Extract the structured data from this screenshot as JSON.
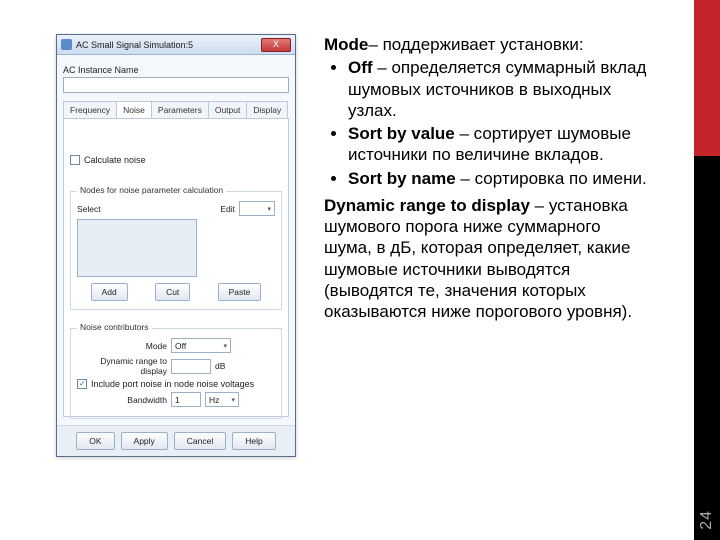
{
  "page_number": "24",
  "dialog": {
    "title": "AC Small Signal Simulation:5",
    "close": "X",
    "instance_label": "AC Instance Name",
    "tabs": [
      "Frequency",
      "Noise",
      "Parameters",
      "Output",
      "Display"
    ],
    "calc_noise": "Calculate noise",
    "nodes_group": {
      "legend": "Nodes for noise parameter calculation",
      "select_label": "Select",
      "edit_label": "Edit",
      "add": "Add",
      "cut": "Cut",
      "paste": "Paste"
    },
    "contrib_group": {
      "legend": "Noise contributors",
      "mode_label": "Mode",
      "mode_value": "Off",
      "dyn_label": "Dynamic range to display",
      "dyn_unit": "dB",
      "include": "Include port noise in node noise voltages",
      "bw_label": "Bandwidth",
      "bw_value": "1",
      "bw_unit": "Hz"
    },
    "buttons": {
      "ok": "OK",
      "apply": "Apply",
      "cancel": "Cancel",
      "help": "Help"
    }
  },
  "body": {
    "l1a": "Mode",
    "l1b": "– поддерживает установки:",
    "li1a": "Off",
    "li1b": " – определяется суммарный вклад шумовых источников в выходных узлах.",
    "li2a": "Sort by value",
    "li2b": " – сортирует шумовые источники по величине вкладов.",
    "li3a": "Sort by name",
    "li3b": " – сортировка по имени.",
    "p2a": "Dynamic range to display",
    "p2b": " – установка шумового порога ниже суммарного шума, в дБ, которая определяет, какие шумовые источники выводятся (выводятся те, значения которых оказываются ниже порогового уровня)."
  }
}
